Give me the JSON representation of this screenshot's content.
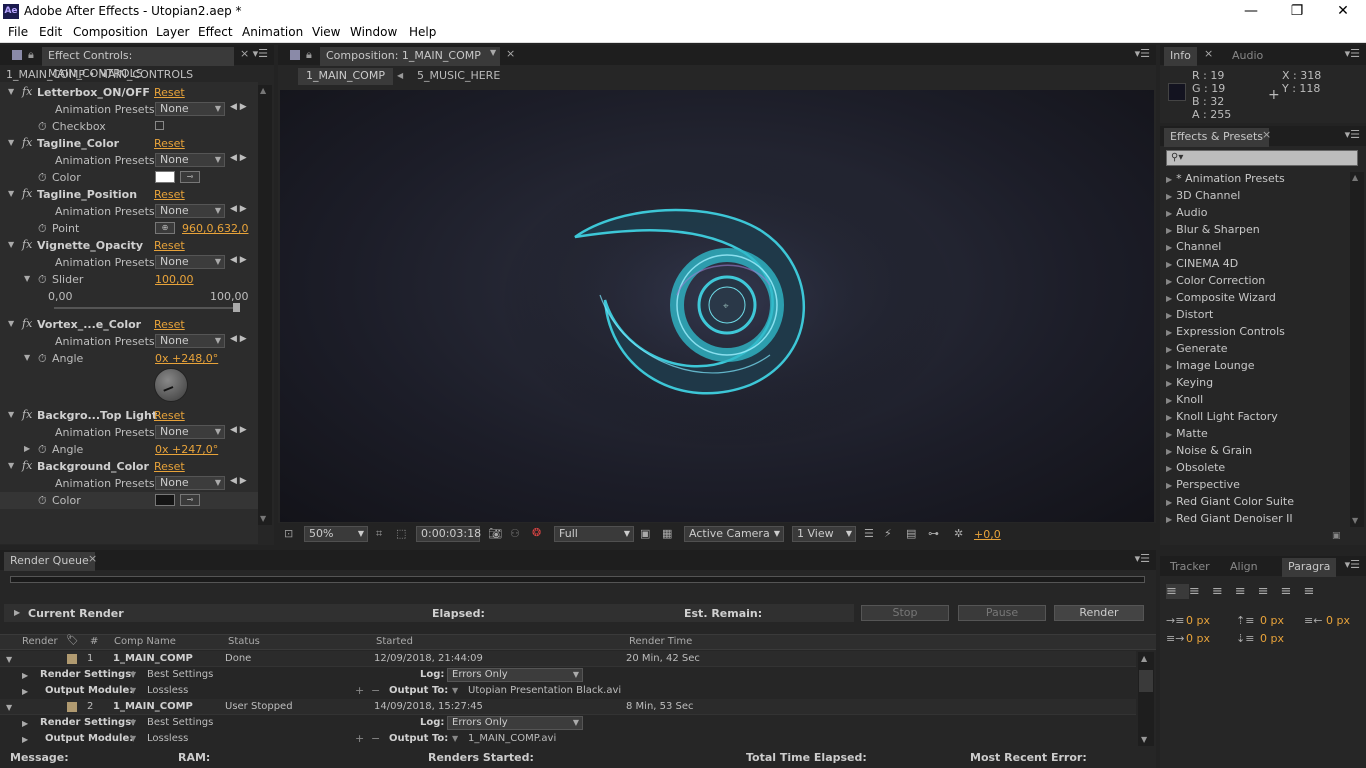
{
  "window": {
    "title": "Adobe After Effects - Utopian2.aep *",
    "logo": "Ae"
  },
  "menu": [
    "File",
    "Edit",
    "Composition",
    "Layer",
    "Effect",
    "Animation",
    "View",
    "Window",
    "Help"
  ],
  "effect_controls": {
    "tab": "Effect Controls: MAIN_CONTROLS",
    "breadcrumb": "1_MAIN_COMP • MAIN_CONTROLS",
    "reset": "Reset",
    "presets_label": "Animation Presets:",
    "presets_value": "None",
    "effects": [
      {
        "name": "Letterbox_ON/OFF",
        "param": "Checkbox"
      },
      {
        "name": "Tagline_Color",
        "param": "Color"
      },
      {
        "name": "Tagline_Position",
        "param": "Point",
        "value": "960,0,632,0"
      },
      {
        "name": "Vignette_Opacity",
        "param": "Slider",
        "value": "100,00",
        "min": "0,00",
        "max": "100,00"
      },
      {
        "name": "Vortex_...e_Color",
        "param": "Angle",
        "value": "0x +248,0°"
      },
      {
        "name": "Backgro...Top Light",
        "param": "Angle",
        "value": "0x +247,0°"
      },
      {
        "name": "Background_Color",
        "param": "Color"
      }
    ]
  },
  "composition": {
    "tab": "Composition: 1_MAIN_COMP",
    "nav": [
      "1_MAIN_COMP",
      "5_MUSIC_HERE"
    ],
    "zoom": "50%",
    "timecode": "0:00:03:18",
    "resolution": "Full",
    "camera": "Active Camera",
    "view": "1 View",
    "exposure": "+0,0"
  },
  "info": {
    "tabs": [
      "Info",
      "Audio"
    ],
    "r": "R : 19",
    "g": "G : 19",
    "b": "B : 32",
    "a": "A : 255",
    "x": "X : 318",
    "y": "Y : 118"
  },
  "effects_presets": {
    "tab": "Effects & Presets",
    "items": [
      "* Animation Presets",
      "3D Channel",
      "Audio",
      "Blur & Sharpen",
      "Channel",
      "CINEMA 4D",
      "Color Correction",
      "Composite Wizard",
      "Distort",
      "Expression Controls",
      "Generate",
      "Image Lounge",
      "Keying",
      "Knoll",
      "Knoll Light Factory",
      "Matte",
      "Noise & Grain",
      "Obsolete",
      "Perspective",
      "Red Giant Color Suite",
      "Red Giant Denoiser II"
    ]
  },
  "paragraph": {
    "tabs": [
      "Tracker",
      "Align",
      "Paragra"
    ],
    "values": [
      "0 px",
      "0 px",
      "0 px",
      "0 px",
      "0 px"
    ]
  },
  "render_queue": {
    "tab": "Render Queue",
    "current_render": "Current Render",
    "elapsed": "Elapsed:",
    "est_remain": "Est. Remain:",
    "buttons": {
      "stop": "Stop",
      "pause": "Pause",
      "render": "Render"
    },
    "columns": [
      "Render",
      "#",
      "Comp Name",
      "Status",
      "Started",
      "Render Time"
    ],
    "items": [
      {
        "num": "1",
        "comp": "1_MAIN_COMP",
        "status": "Done",
        "started": "12/09/2018, 21:44:09",
        "time": "20 Min, 42 Sec",
        "settings": "Best Settings",
        "log": "Errors Only",
        "module": "Lossless",
        "output": "Utopian Presentation Black.avi"
      },
      {
        "num": "2",
        "comp": "1_MAIN_COMP",
        "status": "User Stopped",
        "started": "14/09/2018, 15:27:45",
        "time": "8 Min, 53 Sec",
        "settings": "Best Settings",
        "log": "Errors Only",
        "module": "Lossless",
        "output": "1_MAIN_COMP.avi"
      }
    ],
    "labels": {
      "render_settings": "Render Settings:",
      "output_module": "Output Module:",
      "log": "Log:",
      "output_to": "Output To:"
    },
    "footer": {
      "message": "Message:",
      "ram": "RAM:",
      "renders_started": "Renders Started:",
      "total_time": "Total Time Elapsed:",
      "recent_error": "Most Recent Error:"
    }
  }
}
